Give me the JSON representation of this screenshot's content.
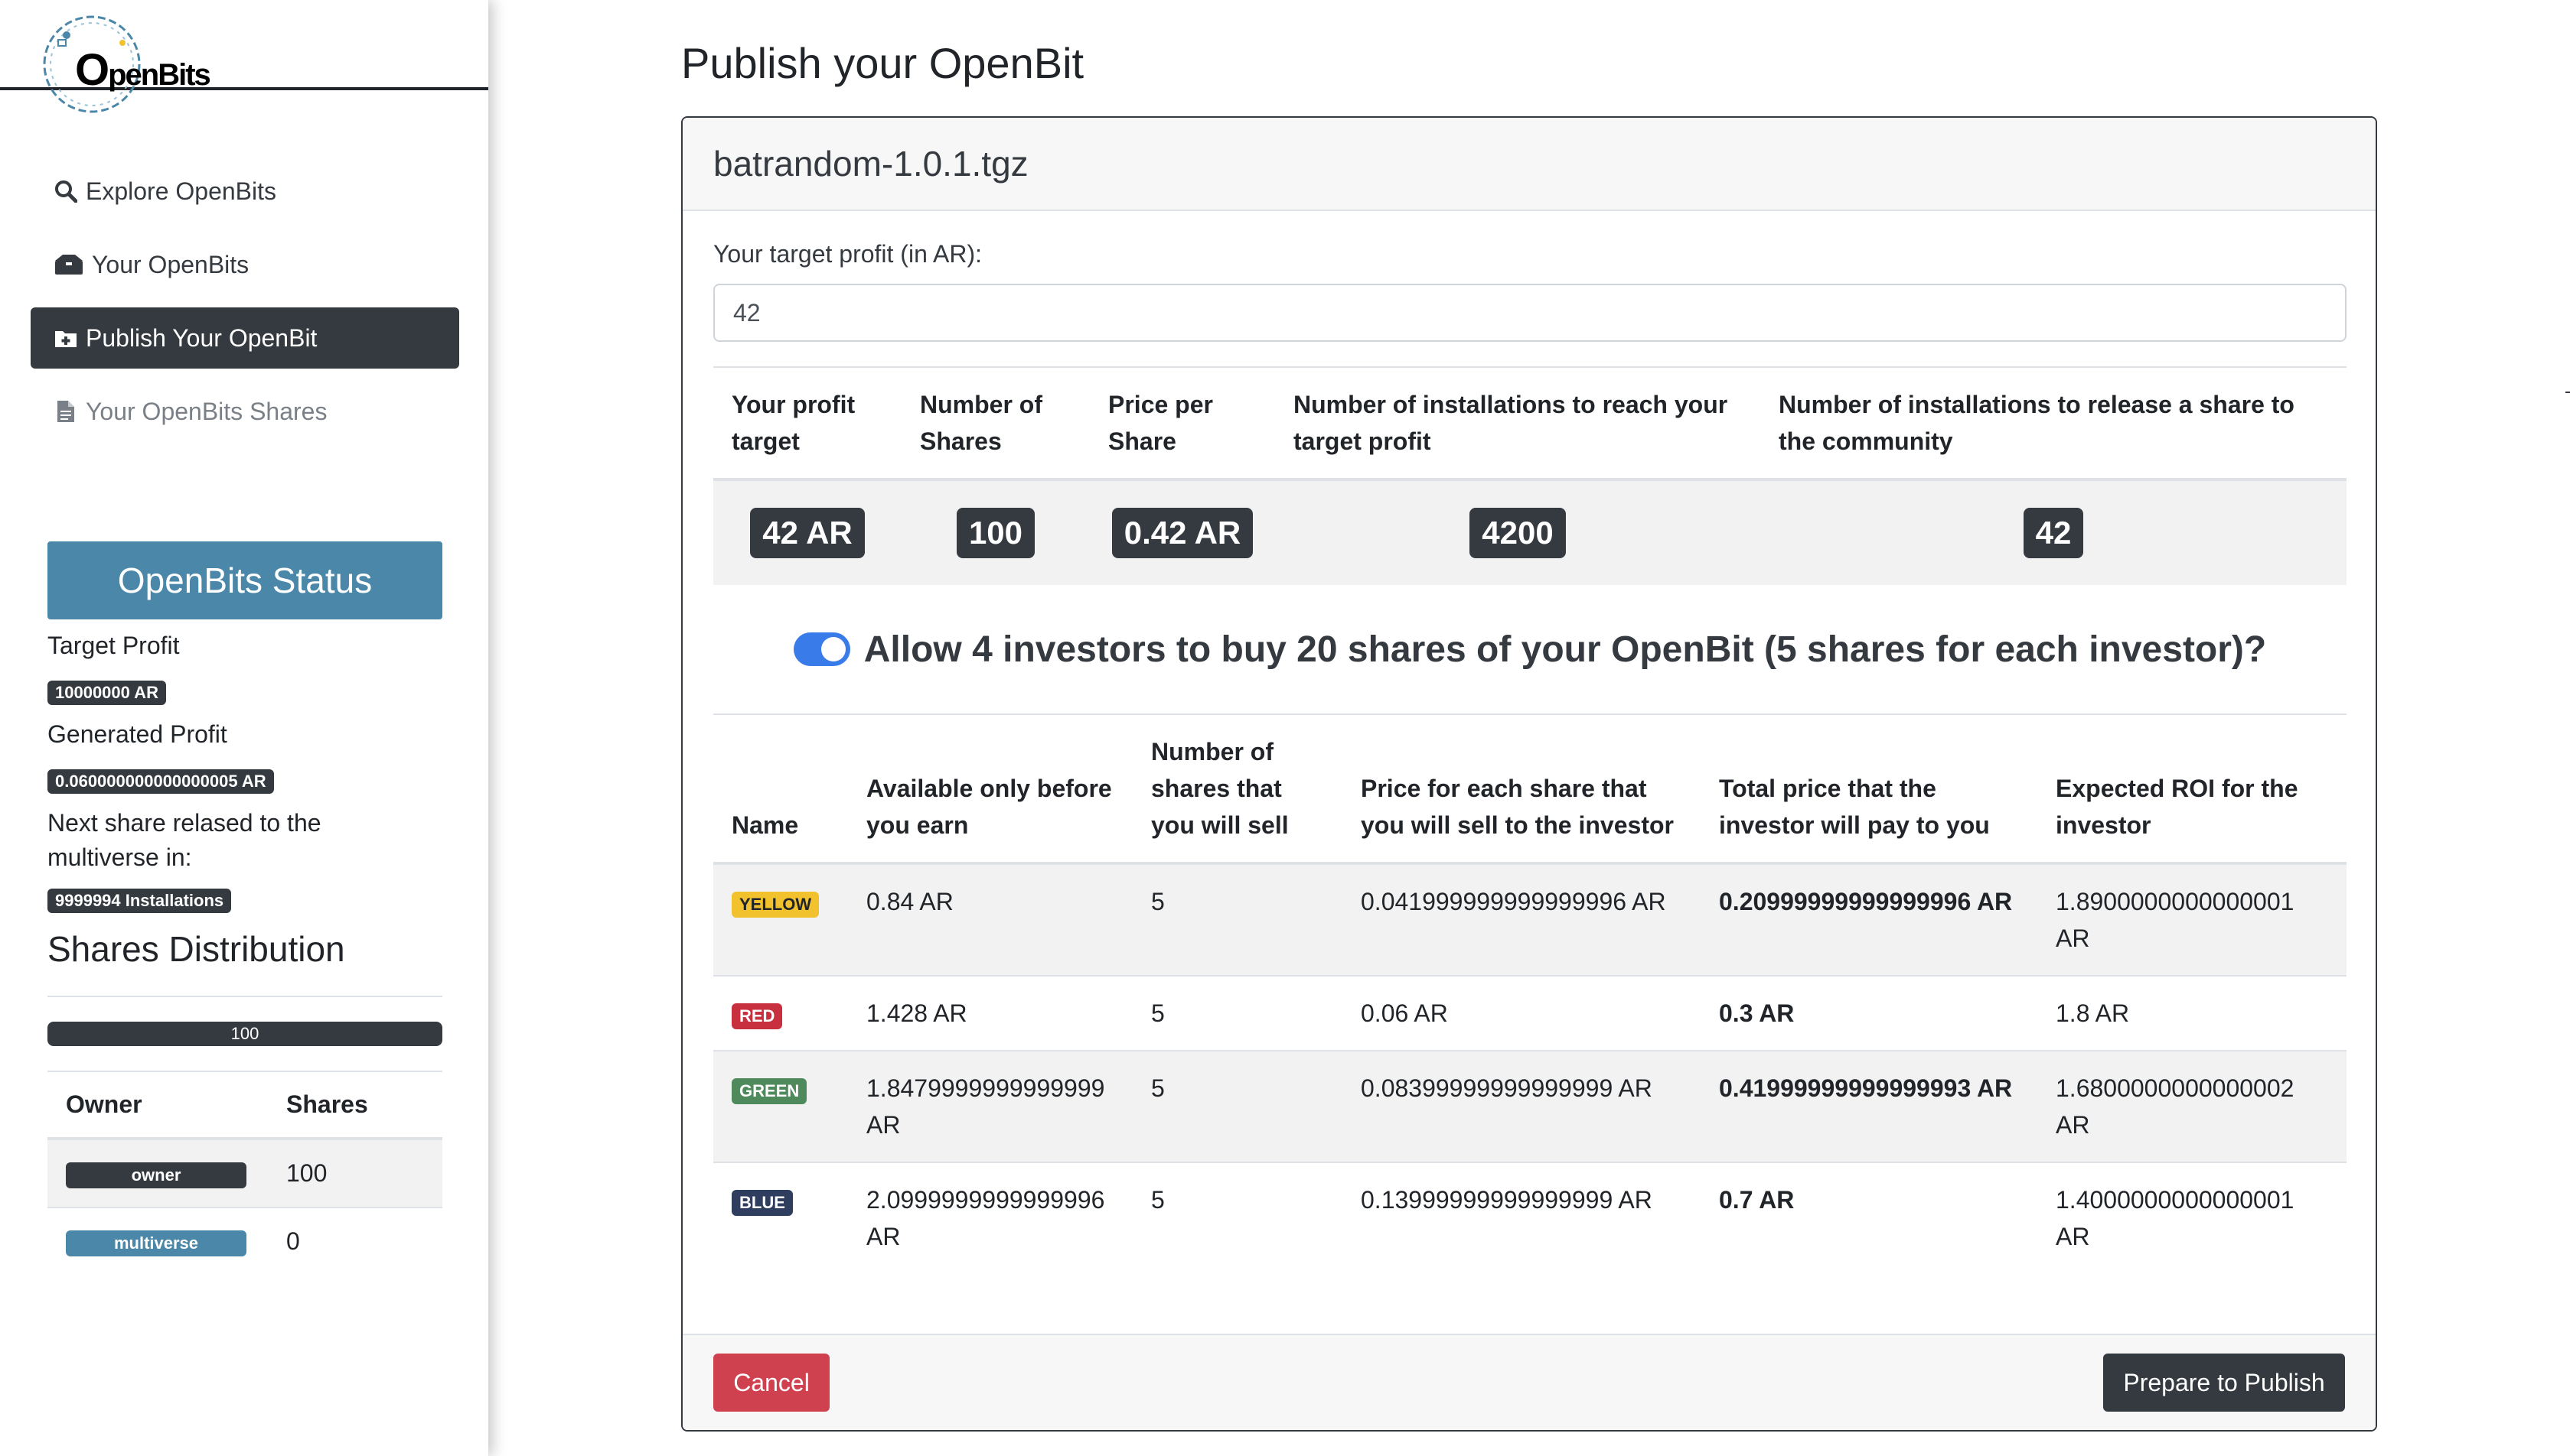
{
  "brand": {
    "logo_text_prefix": "O",
    "logo_text_rest": "penBits"
  },
  "sidebar": {
    "items": [
      {
        "label": "Explore OpenBits",
        "icon": "search-icon"
      },
      {
        "label": "Your OpenBits",
        "icon": "boxes-icon"
      },
      {
        "label": "Publish Your OpenBit",
        "icon": "folder-plus-icon",
        "active": true
      },
      {
        "label": "Your OpenBits Shares",
        "icon": "file-icon"
      }
    ],
    "status": {
      "title": "OpenBits Status",
      "target_profit_label": "Target Profit",
      "target_profit_value": "10000000 AR",
      "generated_profit_label": "Generated Profit",
      "generated_profit_value": "0.060000000000000005 AR",
      "next_share_label": "Next share relased to the multiverse in:",
      "next_share_value": "9999994 Installations"
    },
    "shares_distribution": {
      "title": "Shares Distribution",
      "bar_label": "100",
      "columns": [
        "Owner",
        "Shares"
      ],
      "rows": [
        {
          "owner": "owner",
          "shares": "100",
          "color": "#343a40"
        },
        {
          "owner": "multiverse",
          "shares": "0",
          "color": "#4a87a8"
        }
      ]
    }
  },
  "main": {
    "title": "Publish your OpenBit",
    "file_name": "batrandom-1.0.1.tgz",
    "target_label": "Your target profit (in AR):",
    "target_value": "42",
    "summary": {
      "headers": [
        "Your profit target",
        "Number of Shares",
        "Price per Share",
        "Number of installations to reach your target profit",
        "Number of installations to release a share to the community"
      ],
      "values": [
        "42 AR",
        "100",
        "0.42 AR",
        "4200",
        "42"
      ]
    },
    "allow_text": "Allow 4 investors to buy 20 shares of your OpenBit (5 shares for each investor)?",
    "allow_enabled": true,
    "investors": {
      "headers": [
        "Name",
        "Available only before you earn",
        "Number of shares that you will sell",
        "Price for each share that you will sell to the investor",
        "Total price that the investor will pay to you",
        "Expected ROI for the investor"
      ],
      "rows": [
        {
          "name": "YELLOW",
          "badge_bg": "#f2c12e",
          "badge_fg": "#212529",
          "available": "0.84 AR",
          "shares": "5",
          "price": "0.041999999999999996 AR",
          "total": "0.20999999999999996 AR",
          "roi": "1.8900000000000001 AR"
        },
        {
          "name": "RED",
          "badge_bg": "#c9303f",
          "badge_fg": "#ffffff",
          "available": "1.428 AR",
          "shares": "5",
          "price": "0.06 AR",
          "total": "0.3 AR",
          "roi": "1.8 AR"
        },
        {
          "name": "GREEN",
          "badge_bg": "#4e8a5c",
          "badge_fg": "#ffffff",
          "available": "1.8479999999999999 AR",
          "shares": "5",
          "price": "0.08399999999999999 AR",
          "total": "0.41999999999999993 AR",
          "roi": "1.6800000000000002 AR"
        },
        {
          "name": "BLUE",
          "badge_bg": "#2f3e5e",
          "badge_fg": "#ffffff",
          "available": "2.0999999999999996 AR",
          "shares": "5",
          "price": "0.13999999999999999 AR",
          "total": "0.7 AR",
          "roi": "1.4000000000000001 AR"
        }
      ]
    },
    "cancel_label": "Cancel",
    "publish_label": "Prepare to Publish"
  }
}
